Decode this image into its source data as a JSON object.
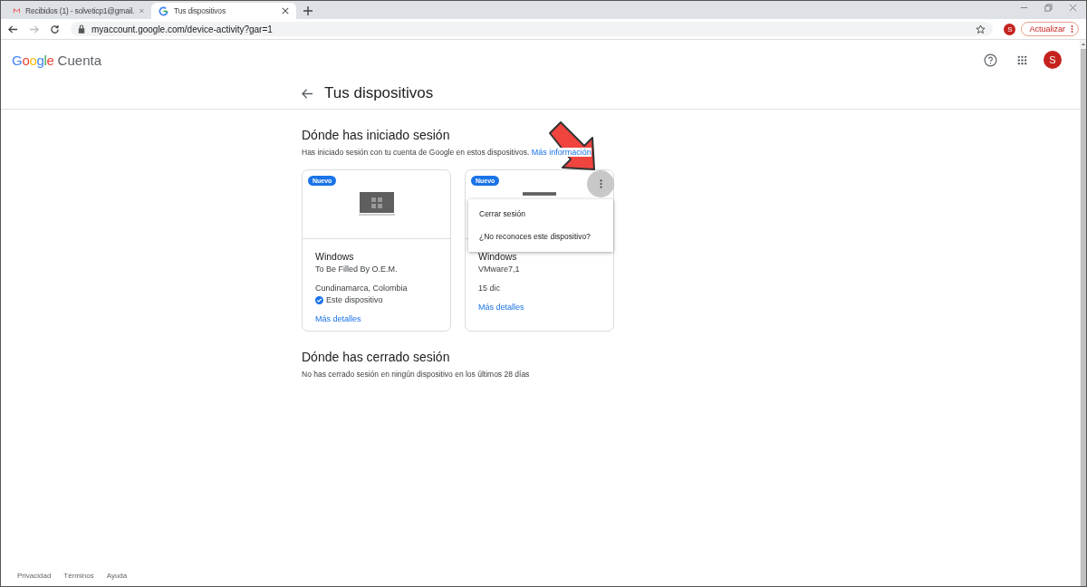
{
  "browser": {
    "tabs": [
      {
        "title": "Recibidos (1) - solveticp1@gmail.",
        "selected": false
      },
      {
        "title": "Tus dispositivos",
        "selected": true
      }
    ],
    "url": "myaccount.google.com/device-activity?gar=1",
    "profile_initial": "S",
    "update_button": "Actualizar"
  },
  "header": {
    "logo": "Google",
    "product": "Cuenta",
    "avatar_initial": "S"
  },
  "page_title": "Tus dispositivos",
  "signed_in": {
    "heading": "Dónde has iniciado sesión",
    "description": "Has iniciado sesión con tu cuenta de Google en estos dispositivos.",
    "link": "Más información",
    "devices": [
      {
        "badge": "Nuevo",
        "name": "Windows",
        "model": "To Be Filled By O.E.M.",
        "location": "Cundinamarca, Colombia",
        "this_device": "Este dispositivo",
        "details_link": "Más detalles",
        "menu_open": false
      },
      {
        "badge": "Nuevo",
        "name": "Windows",
        "model": "VMware7,1",
        "date": "15 dic",
        "details_link": "Más detalles",
        "menu_open": true,
        "menu": [
          "Cerrar sesión",
          "¿No reconoces este dispositivo?"
        ]
      }
    ]
  },
  "signed_out": {
    "heading": "Dónde has cerrado sesión",
    "description": "No has cerrado sesión en ningún dispositivo en los últimos 28 días"
  },
  "footer": [
    "Privacidad",
    "Términos",
    "Ayuda"
  ]
}
